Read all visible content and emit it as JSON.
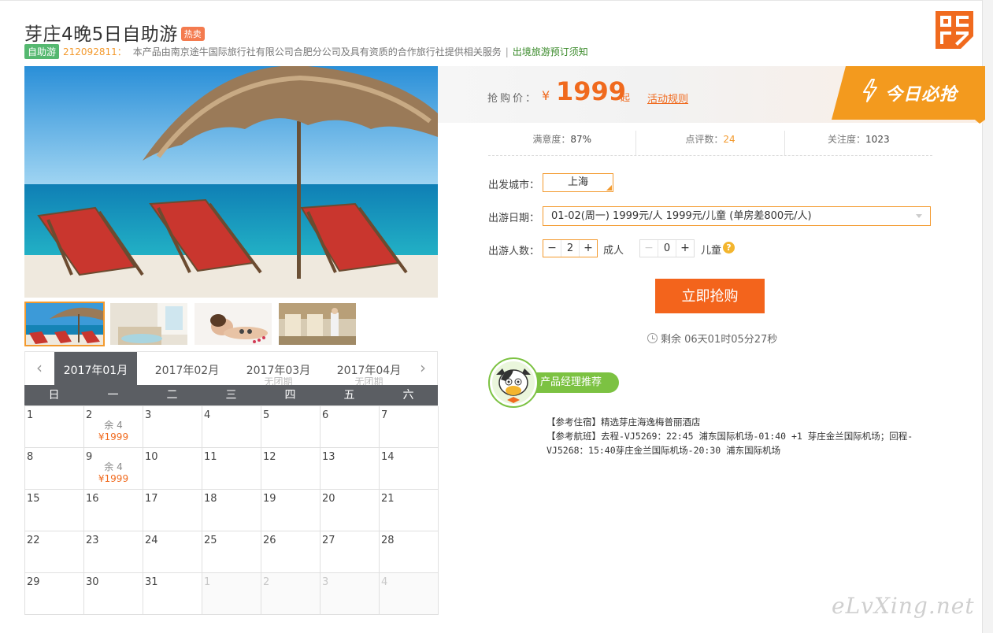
{
  "header": {
    "title": "芽庄4晚5日自助游",
    "hot_badge": "热卖",
    "type_badge": "自助游",
    "product_code": "212092811：",
    "description": "本产品由南京途牛国际旅行社有限公司合肥分公司及具有资质的合作旅行社提供相关服务",
    "separator": "|",
    "notice_link": "出境旅游预订须知"
  },
  "calendar": {
    "prev_arrow": "‹",
    "next_arrow": "›",
    "months": [
      {
        "label": "2017年01月",
        "note": ""
      },
      {
        "label": "2017年02月",
        "note": ""
      },
      {
        "label": "2017年03月",
        "note": "无团期"
      },
      {
        "label": "2017年04月",
        "note": "无团期"
      }
    ],
    "weekdays": [
      "日",
      "一",
      "二",
      "三",
      "四",
      "五",
      "六"
    ],
    "days": [
      {
        "d": "1",
        "rem": "",
        "price": "",
        "out": false
      },
      {
        "d": "2",
        "rem": "余 4",
        "price": "¥1999",
        "out": false
      },
      {
        "d": "3",
        "rem": "",
        "price": "",
        "out": false
      },
      {
        "d": "4",
        "rem": "",
        "price": "",
        "out": false
      },
      {
        "d": "5",
        "rem": "",
        "price": "",
        "out": false
      },
      {
        "d": "6",
        "rem": "",
        "price": "",
        "out": false
      },
      {
        "d": "7",
        "rem": "",
        "price": "",
        "out": false
      },
      {
        "d": "8",
        "rem": "",
        "price": "",
        "out": false
      },
      {
        "d": "9",
        "rem": "余 4",
        "price": "¥1999",
        "out": false
      },
      {
        "d": "10",
        "rem": "",
        "price": "",
        "out": false
      },
      {
        "d": "11",
        "rem": "",
        "price": "",
        "out": false
      },
      {
        "d": "12",
        "rem": "",
        "price": "",
        "out": false
      },
      {
        "d": "13",
        "rem": "",
        "price": "",
        "out": false
      },
      {
        "d": "14",
        "rem": "",
        "price": "",
        "out": false
      },
      {
        "d": "15",
        "rem": "",
        "price": "",
        "out": false
      },
      {
        "d": "16",
        "rem": "",
        "price": "",
        "out": false
      },
      {
        "d": "17",
        "rem": "",
        "price": "",
        "out": false
      },
      {
        "d": "18",
        "rem": "",
        "price": "",
        "out": false
      },
      {
        "d": "19",
        "rem": "",
        "price": "",
        "out": false
      },
      {
        "d": "20",
        "rem": "",
        "price": "",
        "out": false
      },
      {
        "d": "21",
        "rem": "",
        "price": "",
        "out": false
      },
      {
        "d": "22",
        "rem": "",
        "price": "",
        "out": false
      },
      {
        "d": "23",
        "rem": "",
        "price": "",
        "out": false
      },
      {
        "d": "24",
        "rem": "",
        "price": "",
        "out": false
      },
      {
        "d": "25",
        "rem": "",
        "price": "",
        "out": false
      },
      {
        "d": "26",
        "rem": "",
        "price": "",
        "out": false
      },
      {
        "d": "27",
        "rem": "",
        "price": "",
        "out": false
      },
      {
        "d": "28",
        "rem": "",
        "price": "",
        "out": false
      },
      {
        "d": "29",
        "rem": "",
        "price": "",
        "out": false
      },
      {
        "d": "30",
        "rem": "",
        "price": "",
        "out": false
      },
      {
        "d": "31",
        "rem": "",
        "price": "",
        "out": false
      },
      {
        "d": "1",
        "rem": "",
        "price": "",
        "out": true
      },
      {
        "d": "2",
        "rem": "",
        "price": "",
        "out": true
      },
      {
        "d": "3",
        "rem": "",
        "price": "",
        "out": true
      },
      {
        "d": "4",
        "rem": "",
        "price": "",
        "out": true
      }
    ]
  },
  "price": {
    "label": "抢购价：",
    "currency": "¥",
    "amount": "1999",
    "qi": "起",
    "rules_link": "活动规则",
    "today_label": "今日必抢"
  },
  "stats": {
    "satisfaction_label": "满意度：",
    "satisfaction_value": "87%",
    "reviews_label": "点评数：",
    "reviews_value": "24",
    "follows_label": "关注度：",
    "follows_value": "1023"
  },
  "form": {
    "city_label": "出发城市：",
    "city_value": "上海",
    "date_label": "出游日期：",
    "date_value": "01-02(周一) 1999元/人 1999元/儿童 (单房差800元/人)",
    "people_label": "出游人数：",
    "adults_value": "2",
    "adults_unit": "成人",
    "children_value": "0",
    "children_unit": "儿童",
    "minus": "−",
    "plus": "+",
    "help": "?"
  },
  "buy": {
    "button": "立即抢购",
    "countdown": "剩余 06天01时05分27秒"
  },
  "recommend": {
    "tag": "产品经理推荐",
    "hotel": "【参考住宿】精选芽庄海逸梅普丽酒店",
    "flight": "【参考航班】去程-VJ5269：22:45 浦东国际机场-01:40 +1 芽庄金兰国际机场；回程-VJ5268：15:40芽庄金兰国际机场-20:30 浦东国际机场"
  },
  "watermark": "eLvXing.net",
  "colors": {
    "accent_orange": "#f39a2e",
    "price_orange": "#f06a1e",
    "buy_button": "#f3641c",
    "calendar_header": "#5b5e63",
    "green": "#55b870"
  }
}
